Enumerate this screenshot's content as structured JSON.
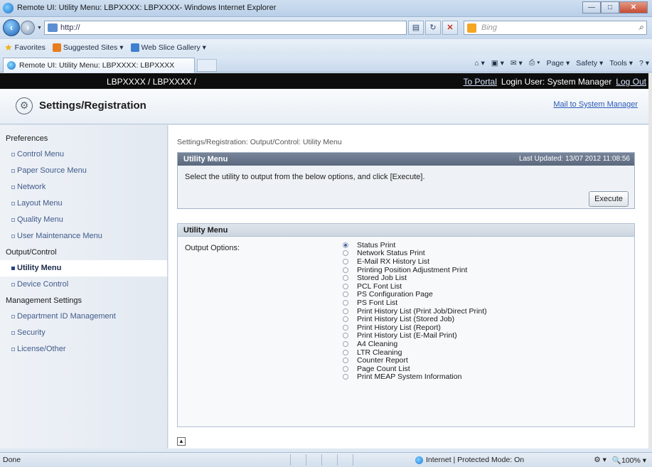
{
  "window": {
    "title": "Remote UI: Utility Menu: LBPXXXX: LBPXXXX- Windows Internet Explorer",
    "minimize": "—",
    "maximize": "□",
    "close": "✕"
  },
  "addressbar": {
    "url": "http://",
    "search_placeholder": "Bing"
  },
  "favorites": {
    "favorites_label": "Favorites",
    "suggested_sites": "Suggested Sites ▾",
    "web_slice_gallery": "Web Slice Gallery ▾"
  },
  "tab": {
    "label": "Remote UI: Utility Menu: LBPXXXX: LBPXXXX"
  },
  "commandbar": {
    "page": "Page ▾",
    "safety": "Safety ▾",
    "tools": "Tools ▾"
  },
  "header": {
    "device": "LBPXXXX / LBPXXXX /",
    "to_portal": "To Portal",
    "login_user": "Login User: System Manager",
    "log_out": "Log Out"
  },
  "page": {
    "title": "Settings/Registration",
    "mail_link": "Mail to System Manager",
    "breadcrumb": "Settings/Registration: Output/Control: Utility Menu"
  },
  "sidebar": {
    "sections": [
      {
        "title": "Preferences",
        "items": [
          "Control Menu",
          "Paper Source Menu",
          "Network",
          "Layout Menu",
          "Quality Menu",
          "User Maintenance Menu"
        ]
      },
      {
        "title": "Output/Control",
        "items": [
          "Utility Menu",
          "Device Control"
        ]
      },
      {
        "title": "Management Settings",
        "items": [
          "Department ID Management",
          "Security",
          "License/Other"
        ]
      }
    ]
  },
  "utility_panel": {
    "title": "Utility Menu",
    "last_updated": "Last Updated: 13/07 2012 11:08:56",
    "instructions": "Select the utility to output from the below options, and click [Execute].",
    "execute": "Execute"
  },
  "options_panel": {
    "title": "Utility Menu",
    "label": "Output Options:",
    "options": [
      "Status Print",
      "Network Status Print",
      "E-Mail RX History List",
      "Printing Position Adjustment Print",
      "Stored Job List",
      "PCL Font List",
      "PS Configuration Page",
      "PS Font List",
      "Print History List (Print Job/Direct Print)",
      "Print History List (Stored Job)",
      "Print History List (Report)",
      "Print History List (E-Mail Print)",
      "A4 Cleaning",
      "LTR Cleaning",
      "Counter Report",
      "Page Count List",
      "Print MEAP System Information"
    ],
    "selected_index": 0
  },
  "statusbar": {
    "status": "Done",
    "zone": "Internet | Protected Mode: On",
    "zoom": "100%"
  }
}
